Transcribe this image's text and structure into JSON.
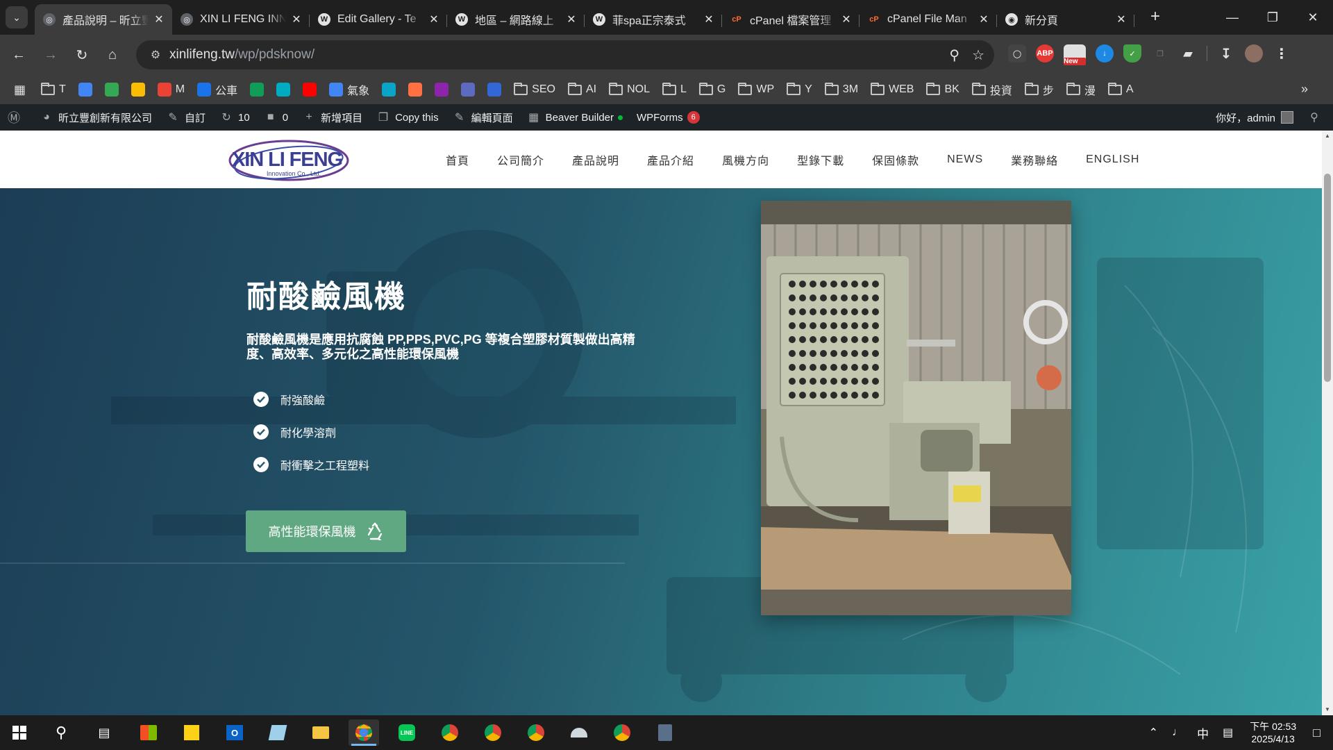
{
  "browser": {
    "tabs": [
      {
        "title": "產品說明 – 昕立豐",
        "icon": "globe-icon",
        "active": true
      },
      {
        "title": "XIN LI FENG INN",
        "icon": "globe-icon",
        "active": false
      },
      {
        "title": "Edit Gallery - Te",
        "icon": "wordpress-icon",
        "active": false
      },
      {
        "title": "地區 – 網路線上",
        "icon": "wordpress-icon",
        "active": false
      },
      {
        "title": "菲spa正宗泰式",
        "icon": "wordpress-icon",
        "active": false
      },
      {
        "title": "cPanel 檔案管理",
        "icon": "cpanel-icon",
        "active": false
      },
      {
        "title": "cPanel File Man",
        "icon": "cpanel-icon",
        "active": false
      },
      {
        "title": "新分頁",
        "icon": "chrome-icon",
        "active": false
      }
    ],
    "url_host": "xinlifeng.tw",
    "url_path": "/wp/pdsknow/",
    "ext_new_badge": "New",
    "ext_abp": "ABP",
    "bookmarks": [
      {
        "label": "T",
        "type": "folder"
      },
      {
        "label": "",
        "type": "icon",
        "icon": "p-icon"
      },
      {
        "label": "",
        "type": "icon",
        "icon": "gs-icon"
      },
      {
        "label": "",
        "type": "icon",
        "icon": "maps-icon"
      },
      {
        "label": "M",
        "type": "icon",
        "icon": "maps-icon"
      },
      {
        "label": "公車",
        "type": "icon",
        "icon": "bus-icon"
      },
      {
        "label": "",
        "type": "icon",
        "icon": "image-icon"
      },
      {
        "label": "",
        "type": "icon",
        "icon": "translate-icon"
      },
      {
        "label": "",
        "type": "icon",
        "icon": "calendar-icon"
      },
      {
        "label": "氣象",
        "type": "icon",
        "icon": "weather-icon"
      },
      {
        "label": "",
        "type": "icon",
        "icon": "chat-icon"
      },
      {
        "label": "",
        "type": "icon",
        "icon": "youtube-icon"
      },
      {
        "label": "",
        "type": "icon",
        "icon": "ads-icon"
      },
      {
        "label": "",
        "type": "icon",
        "icon": "map-icon"
      },
      {
        "label": "",
        "type": "icon",
        "icon": "stamp-icon"
      },
      {
        "label": "SEO",
        "type": "folder"
      },
      {
        "label": "AI",
        "type": "folder"
      },
      {
        "label": "NOL",
        "type": "folder"
      },
      {
        "label": "L",
        "type": "folder"
      },
      {
        "label": "G",
        "type": "folder"
      },
      {
        "label": "WP",
        "type": "folder"
      },
      {
        "label": "Y",
        "type": "folder"
      },
      {
        "label": "3M",
        "type": "folder"
      },
      {
        "label": "WEB",
        "type": "folder"
      },
      {
        "label": "BK",
        "type": "folder"
      },
      {
        "label": "投資",
        "type": "folder"
      },
      {
        "label": "步",
        "type": "folder"
      },
      {
        "label": "漫",
        "type": "folder"
      },
      {
        "label": "A",
        "type": "folder"
      }
    ]
  },
  "wp_admin": {
    "site_name": "昕立豐創新有限公司",
    "customize": "自訂",
    "updates": "10",
    "comments": "0",
    "new_item": "新增項目",
    "copy_this": "Copy this",
    "edit_page": "編輯頁面",
    "beaver": "Beaver Builder",
    "wpforms": "WPForms",
    "wpforms_badge": "6",
    "greeting": "你好，admin"
  },
  "site": {
    "logo_text": "XIN LI FENG",
    "logo_sub": "Innovation Co., Ltd.",
    "nav": [
      "首頁",
      "公司簡介",
      "產品說明",
      "產品介紹",
      "風機方向",
      "型錄下載",
      "保固條款",
      "NEWS",
      "業務聯絡",
      "ENGLISH"
    ],
    "hero": {
      "title": "耐酸鹼風機",
      "lead": "耐酸鹼風機是應用抗腐蝕 PP,PPS,PVC,PG 等複合塑膠材質製做出高精度、高效率、多元化之高性能環保風機",
      "features": [
        "耐強酸鹼",
        "耐化學溶劑",
        "耐衝擊之工程塑料"
      ],
      "cta": "高性能環保風機"
    }
  },
  "taskbar": {
    "ime": "中",
    "time_period": "下午 02:53",
    "date": "2025/4/13"
  },
  "colors": {
    "cta": "#5fa882",
    "hero_dark": "#1c3d55",
    "hero_light": "#3aa2a8",
    "wp_bar": "#1d2327",
    "badge": "#d63638"
  }
}
